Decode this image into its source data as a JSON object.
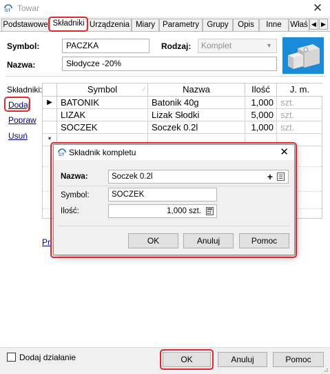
{
  "window": {
    "title": "Towar"
  },
  "tabs": [
    {
      "label": "Podstawowe"
    },
    {
      "label": "Składniki"
    },
    {
      "label": "Urządzenia"
    },
    {
      "label": "Miary"
    },
    {
      "label": "Parametry"
    },
    {
      "label": "Grupy"
    },
    {
      "label": "Opis"
    },
    {
      "label": "Inne"
    },
    {
      "label": "Właś"
    }
  ],
  "form": {
    "symbol_label": "Symbol:",
    "symbol_value": "PACZKA",
    "rodzaj_label": "Rodzaj:",
    "rodzaj_value": "Komplet",
    "nazwa_label": "Nazwa:",
    "nazwa_value": "Słodycze -20%"
  },
  "side": {
    "skladniki_label": "Składniki:",
    "dodaj": "Dodaj",
    "popraw": "Popraw",
    "usun": "Usuń",
    "hidden_link_fragment": "Pr"
  },
  "grid": {
    "headers": [
      "Symbol",
      "Nazwa",
      "Ilość",
      "J. m."
    ],
    "rows": [
      {
        "symbol": "BATONIK",
        "nazwa": "Batonik 40g",
        "ilosc": "1,000",
        "jm": "szt."
      },
      {
        "symbol": "LIZAK",
        "nazwa": "Lizak Słodki",
        "ilosc": "5,000",
        "jm": "szt."
      },
      {
        "symbol": "SOCZEK",
        "nazwa": "Soczek 0.2l",
        "ilosc": "1,000",
        "jm": "szt."
      }
    ],
    "current_row_marker": "▶",
    "new_row_marker": "*"
  },
  "dialog": {
    "title": "Składnik kompletu",
    "nazwa_label": "Nazwa:",
    "nazwa_value": "Soczek 0.2l",
    "symbol_label": "Symbol:",
    "symbol_value": "SOCZEK",
    "ilosc_label": "Ilość:",
    "ilosc_value": "1,000 szt.",
    "ok": "OK",
    "anuluj": "Anuluj",
    "pomoc": "Pomoc"
  },
  "footer": {
    "dodaj_dzialanie": "Dodaj działanie",
    "ok": "OK",
    "anuluj": "Anuluj",
    "pomoc": "Pomoc"
  },
  "colors": {
    "highlight": "#e0282e",
    "link": "#000080"
  }
}
